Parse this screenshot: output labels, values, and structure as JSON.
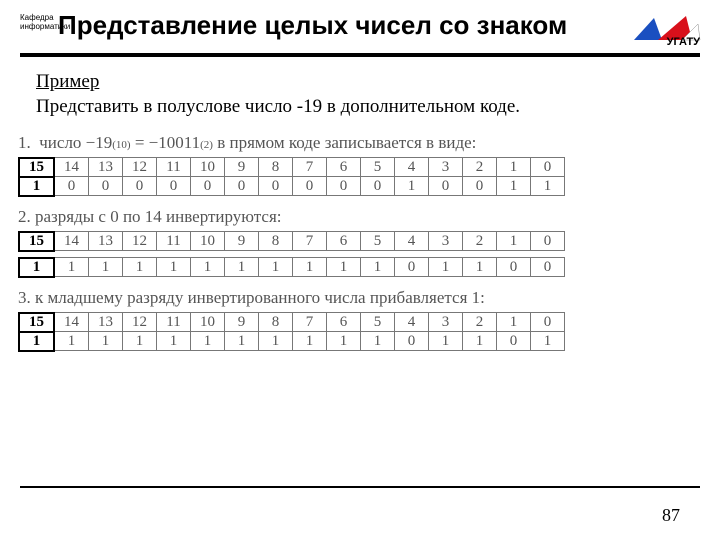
{
  "header": {
    "dept_l1": "Кафедра",
    "dept_l2": "информатики",
    "title": "Представление целых чисел со знаком",
    "org": "УГАТУ"
  },
  "example": {
    "heading": "Пример",
    "task": "Представить в полуслове число -19 в дополнительном коде."
  },
  "steps": {
    "s1_num": "1.",
    "s1_text_a": "число −19",
    "s1_sub1": "(10)",
    "s1_text_b": " = −10011",
    "s1_sub2": "(2)",
    "s1_text_c": "  в прямом коде записывается в виде:",
    "s2_num": "2.",
    "s2_text": "разряды с 0 по 14 инвертируются:",
    "s3_num": "3.",
    "s3_text": "к младшему разряду инвертированного числа прибавляется 1:"
  },
  "bit_positions": [
    "15",
    "14",
    "13",
    "12",
    "11",
    "10",
    "9",
    "8",
    "7",
    "6",
    "5",
    "4",
    "3",
    "2",
    "1",
    "0"
  ],
  "rows": {
    "r1": [
      "1",
      "0",
      "0",
      "0",
      "0",
      "0",
      "0",
      "0",
      "0",
      "0",
      "0",
      "1",
      "0",
      "0",
      "1",
      "1"
    ],
    "r2": [
      "1",
      "1",
      "1",
      "1",
      "1",
      "1",
      "1",
      "1",
      "1",
      "1",
      "1",
      "0",
      "1",
      "1",
      "0",
      "0"
    ],
    "r3": [
      "1",
      "1",
      "1",
      "1",
      "1",
      "1",
      "1",
      "1",
      "1",
      "1",
      "1",
      "0",
      "1",
      "1",
      "0",
      "1"
    ]
  },
  "page": "87"
}
